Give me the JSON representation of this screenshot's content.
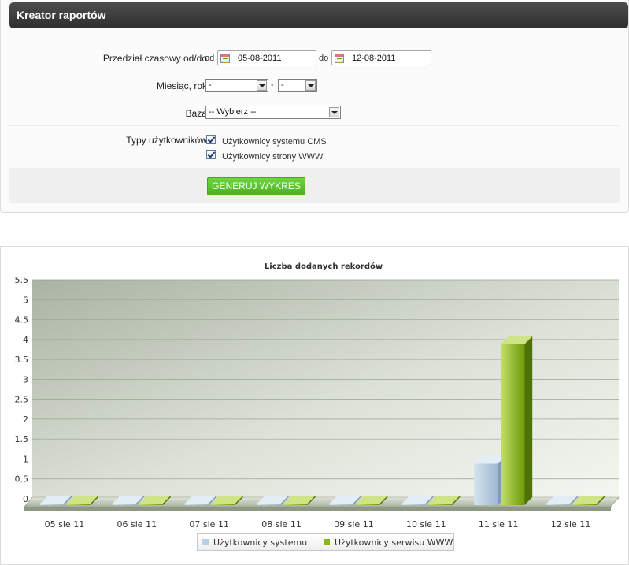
{
  "panel": {
    "title": "Kreator raportów"
  },
  "form": {
    "date_range": {
      "label": "Przedział czasowy od/do",
      "from_prefix": "od",
      "from_value": "05-08-2011",
      "to_prefix": "do",
      "to_value": "12-08-2011"
    },
    "month_year": {
      "label": "Miesiąc, rok",
      "month_value": "-",
      "separator": "-",
      "year_value": "-"
    },
    "database": {
      "label": "Baza",
      "value": "-- Wybierz --"
    },
    "user_types": {
      "label": "Typy użytkowników",
      "options": [
        {
          "label": "Użytkownicy systemu CMS",
          "checked": true
        },
        {
          "label": "Użytkownicy strony WWW",
          "checked": true
        }
      ]
    },
    "generate_label": "GENERUJ WYKRES"
  },
  "colors": {
    "series_blue": "#b9d1e6",
    "series_green": "#86b814",
    "header_dark": "#3a3a3a",
    "button_green": "#5cc22d"
  },
  "chart_data": {
    "type": "bar",
    "title": "Liczba dodanych rekordów",
    "categories": [
      "05 sie 11",
      "06 sie 11",
      "07 sie 11",
      "08 sie 11",
      "09 sie 11",
      "10 sie 11",
      "11 sie 11",
      "12 sie 11"
    ],
    "series": [
      {
        "name": "Użytkownicy systemu",
        "values": [
          0,
          0,
          0,
          0,
          0,
          0,
          1,
          0
        ]
      },
      {
        "name": "Użytkownicy serwisu WWW",
        "values": [
          0,
          0,
          0,
          0,
          0,
          0,
          4,
          0
        ]
      }
    ],
    "ylim": [
      0,
      5.5
    ],
    "yticks": [
      "0",
      "0.5",
      "1",
      "1.5",
      "2",
      "2.5",
      "3",
      "3.5",
      "4",
      "4.5",
      "5",
      "5.5"
    ],
    "grid": true,
    "legend_position": "bottom"
  }
}
